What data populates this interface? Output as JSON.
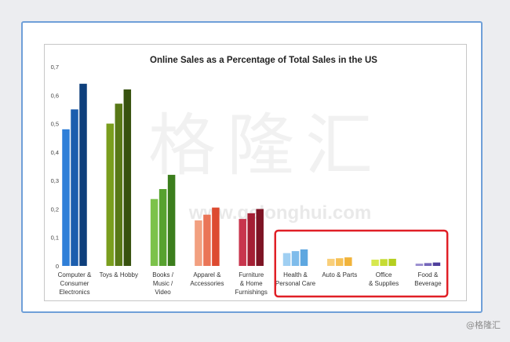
{
  "chart_data": {
    "type": "bar",
    "title": "Online Sales as a Percentage of Total Sales in the US",
    "xlabel": "",
    "ylabel": "",
    "ylim": [
      0,
      0.7
    ],
    "yticks": [
      "0",
      "0,1",
      "0,2",
      "0,3",
      "0,4",
      "0,5",
      "0,6",
      "0,7"
    ],
    "grid": false,
    "legend": "none",
    "categories": [
      [
        "Computer &",
        "Consumer",
        "Electronics"
      ],
      [
        "Toys & Hobby"
      ],
      [
        "Books /",
        "Music /",
        "Video"
      ],
      [
        "Apparel &",
        "Accessories"
      ],
      [
        "Furniture",
        "& Home",
        "Furnishings"
      ],
      [
        "Health &",
        "Personal Care"
      ],
      [
        "Auto & Parts"
      ],
      [
        "Office",
        "& Supplies"
      ],
      [
        "Food &",
        "Beverage"
      ]
    ],
    "groups": [
      {
        "values": [
          0.48,
          0.55,
          0.64
        ],
        "colors": [
          "#2f7fd8",
          "#1c5eae",
          "#0e3f7c"
        ]
      },
      {
        "values": [
          0.5,
          0.57,
          0.62
        ],
        "colors": [
          "#7a9e1e",
          "#587817",
          "#37520f"
        ]
      },
      {
        "values": [
          0.235,
          0.27,
          0.32
        ],
        "colors": [
          "#7cc24a",
          "#57a22f",
          "#3c7e1d"
        ]
      },
      {
        "values": [
          0.16,
          0.18,
          0.205
        ],
        "colors": [
          "#f2a080",
          "#ea7557",
          "#dd4a30"
        ]
      },
      {
        "values": [
          0.165,
          0.185,
          0.2
        ],
        "colors": [
          "#c8354d",
          "#a41f34",
          "#7d1424"
        ]
      },
      {
        "values": [
          0.045,
          0.052,
          0.058
        ],
        "colors": [
          "#9fcff2",
          "#7fbceb",
          "#5ea7e0"
        ]
      },
      {
        "values": [
          0.025,
          0.027,
          0.03
        ],
        "colors": [
          "#f9cf7a",
          "#f6c157",
          "#f1b33a"
        ]
      },
      {
        "values": [
          0.022,
          0.024,
          0.025
        ],
        "colors": [
          "#d7e84e",
          "#c6dc33",
          "#b5cf20"
        ]
      },
      {
        "values": [
          0.008,
          0.01,
          0.012
        ],
        "colors": [
          "#9a8fd0",
          "#7566ba",
          "#4f3f9c"
        ]
      }
    ],
    "highlight": {
      "from_category": 5,
      "to_category": 8,
      "color": "#e01f26"
    }
  },
  "watermark": {
    "chinese": "格隆汇",
    "url": "www.gelonghui.com"
  },
  "credit": "@格隆汇"
}
